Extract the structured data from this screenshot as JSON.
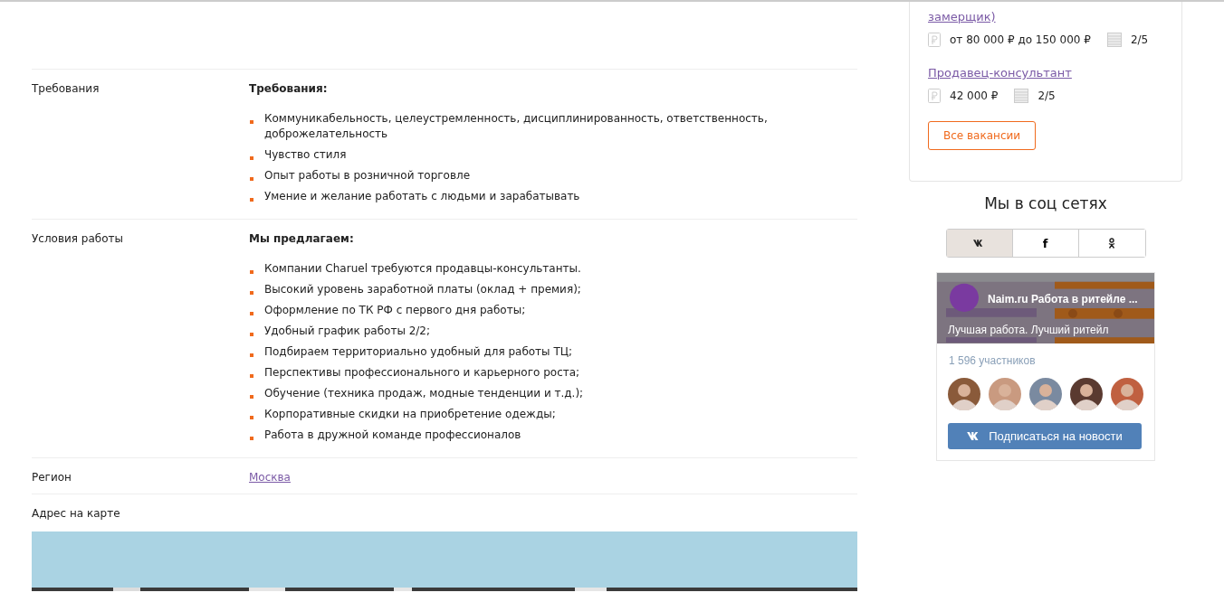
{
  "details": [
    {
      "label": "Требования",
      "heading": "Требования:",
      "items": [
        "Коммуникабельность, целеустремленность, дисциплинированность, ответственность, доброжелательность",
        "Чувство стиля",
        "Опыт работы в розничной торговле",
        "Умение и желание работать с людьми и зарабатывать"
      ]
    },
    {
      "label": "Условия работы",
      "heading": "Мы предлагаем:",
      "items": [
        "Компании Charuel требуются продавцы-консультанты.",
        "Высокий уровень заработной платы (оклад + премия);",
        "Оформление по ТК РФ с первого дня работы;",
        "Удобный график работы 2/2;",
        "Подбираем территориально удобный для работы ТЦ;",
        "Перспективы профессионального и карьерного роста;",
        "Обучение (техника продаж, модные тенденции и т.д.);",
        "Корпоративные скидки на приобретение одежды;",
        "Работа в дружной команде профессионалов"
      ]
    },
    {
      "label": "Регион",
      "link": "Москва"
    },
    {
      "label": "Адрес на карте"
    }
  ],
  "vacancies": [
    {
      "title": "замерщик)",
      "salary": "от 80 000 ₽ до 150 000 ₽",
      "count": "2/5"
    },
    {
      "title": "Продавец-консультант",
      "salary": "42 000 ₽",
      "count": "2/5"
    }
  ],
  "all_button": "Все вакансии",
  "social": {
    "title": "Мы в соц сетях",
    "tabs": [
      {
        "kind": "vk",
        "selected": true
      },
      {
        "kind": "fb",
        "label": "f",
        "selected": false
      },
      {
        "kind": "ok",
        "selected": false
      }
    ]
  },
  "widget": {
    "name": "Naim.ru Работа в ритейле ...",
    "slogan": "Лучшая работа. Лучший ритейл",
    "members": "1 596 участников",
    "subscribe": "Подписаться на новости"
  }
}
